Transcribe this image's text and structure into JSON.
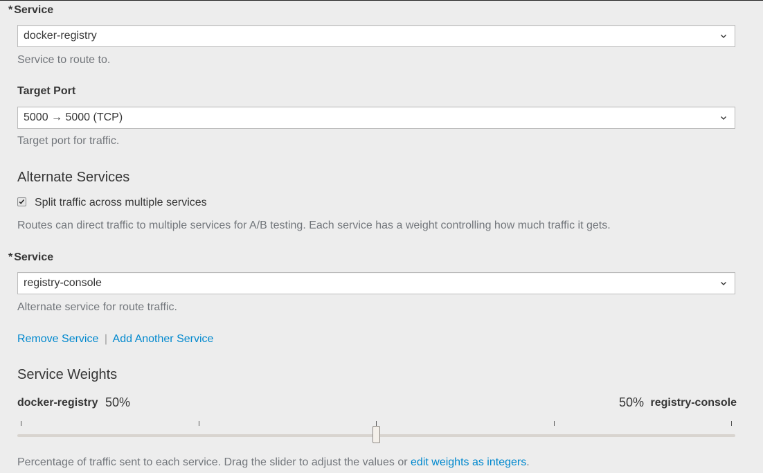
{
  "service": {
    "required_marker": "*",
    "label": "Service",
    "value": "docker-registry",
    "help": "Service to route to."
  },
  "target_port": {
    "label": "Target Port",
    "value": "5000 → 5000 (TCP)",
    "help": "Target port for traffic."
  },
  "alternate_services": {
    "heading": "Alternate Services",
    "split_label": "Split traffic across multiple services",
    "split_checked": true,
    "description": "Routes can direct traffic to multiple services for A/B testing. Each service has a weight controlling how much traffic it gets."
  },
  "alt_service": {
    "required_marker": "*",
    "label": "Service",
    "value": "registry-console",
    "help": "Alternate service for route traffic."
  },
  "links": {
    "remove": "Remove Service",
    "separator": "|",
    "add": "Add Another Service"
  },
  "weights": {
    "heading": "Service Weights",
    "left_name": "docker-registry",
    "left_pct": "50%",
    "right_pct": "50%",
    "right_name": "registry-console",
    "slider_value": 0.5,
    "help_prefix": "Percentage of traffic sent to each service. Drag the slider to adjust the values or ",
    "help_link": "edit weights as integers",
    "help_suffix": "."
  },
  "colors": {
    "background": "#ededed",
    "link": "#0088ce",
    "text": "#363636",
    "help_text": "#72767b"
  }
}
